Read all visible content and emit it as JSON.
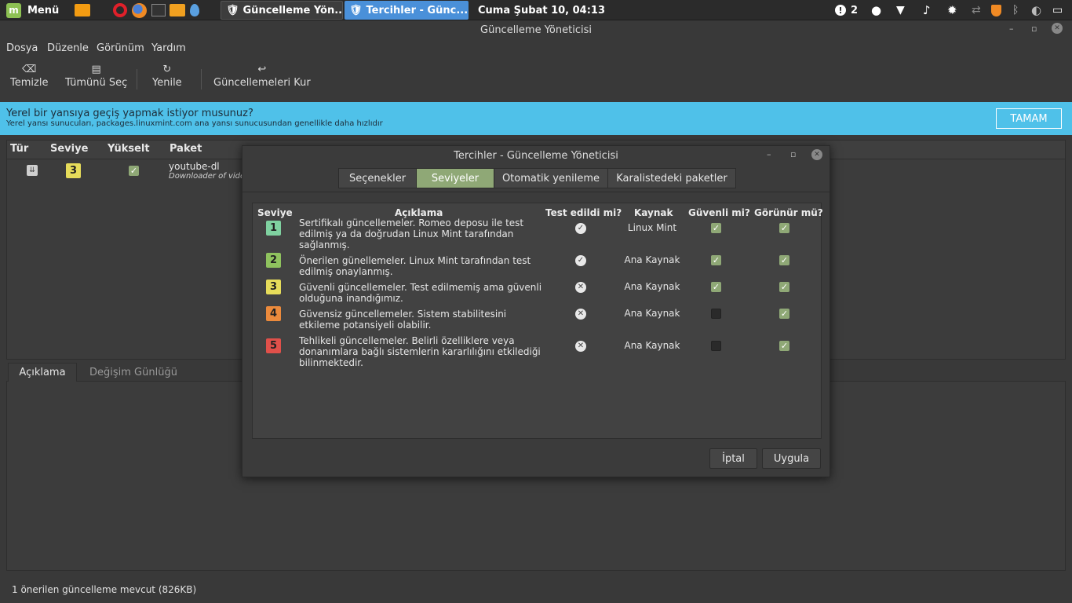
{
  "panel": {
    "menu_label": "Menü",
    "tasks": [
      "Güncelleme Yön...",
      "Tercihler - Günc..."
    ],
    "clock": "Cuma Şubat 10, 04:13",
    "notification_count": "2"
  },
  "window": {
    "title": "Güncelleme Yöneticisi",
    "menus": [
      "Dosya",
      "Düzenle",
      "Görünüm",
      "Yardım"
    ],
    "toolbar": [
      "Temizle",
      "Tümünü Seç",
      "Yenile",
      "Güncellemeleri Kur"
    ],
    "infobar": {
      "title": "Yerel bir yansıya geçiş yapmak istiyor musunuz?",
      "subtitle": "Yerel yansı sunucuları, packages.linuxmint.com ana yansı sunucusundan genellikle daha hızlıdır",
      "button": "TAMAM"
    },
    "table": {
      "headers": [
        "Tür",
        "Seviye",
        "Yükselt",
        "Paket"
      ],
      "row": {
        "level": "3",
        "package": "youtube-dl",
        "desc": "Downloader of vide"
      }
    },
    "bottom_tabs": [
      "Açıklama",
      "Değişim Günlüğü"
    ],
    "status": "1 önerilen güncelleme mevcut (826KB)"
  },
  "dialog": {
    "title": "Tercihler - Güncelleme Yöneticisi",
    "tabs": [
      "Seçenekler",
      "Seviyeler",
      "Otomatik yenileme",
      "Karalistedeki paketler"
    ],
    "headers": [
      "Seviye",
      "Açıklama",
      "Test edildi mi?",
      "Kaynak",
      "Güvenli mi?",
      "Görünür mü?"
    ],
    "levels": [
      {
        "n": "1",
        "color": "#7fd1a0",
        "desc": "Sertifikalı güncellemeler. Romeo deposu ile test edilmiş ya da doğrudan Linux Mint tarafından sağlanmış.",
        "tested": true,
        "source": "Linux Mint",
        "safe": true,
        "visible": true
      },
      {
        "n": "2",
        "color": "#8fc25e",
        "desc": "Önerilen günellemeler. Linux Mint tarafından test edilmiş onaylanmış.",
        "tested": true,
        "source": "Ana Kaynak",
        "safe": true,
        "visible": true
      },
      {
        "n": "3",
        "color": "#e6dc5a",
        "desc": "Güvenli güncellemeler. Test edilmemiş ama güvenli olduğuna inandığımız.",
        "tested": false,
        "source": "Ana Kaynak",
        "safe": true,
        "visible": true
      },
      {
        "n": "4",
        "color": "#eb8a3c",
        "desc": "Güvensiz güncellemeler. Sistem stabilitesini etkileme potansiyeli olabilir.",
        "tested": false,
        "source": "Ana Kaynak",
        "safe": false,
        "visible": true
      },
      {
        "n": "5",
        "color": "#e0504a",
        "desc": "Tehlikeli güncellemeler. Belirli özelliklere veya donanımlara bağlı sistemlerin kararlılığını etkilediği bilinmektedir.",
        "tested": false,
        "source": "Ana Kaynak",
        "safe": false,
        "visible": true
      }
    ],
    "buttons": {
      "cancel": "İptal",
      "apply": "Uygula"
    }
  }
}
